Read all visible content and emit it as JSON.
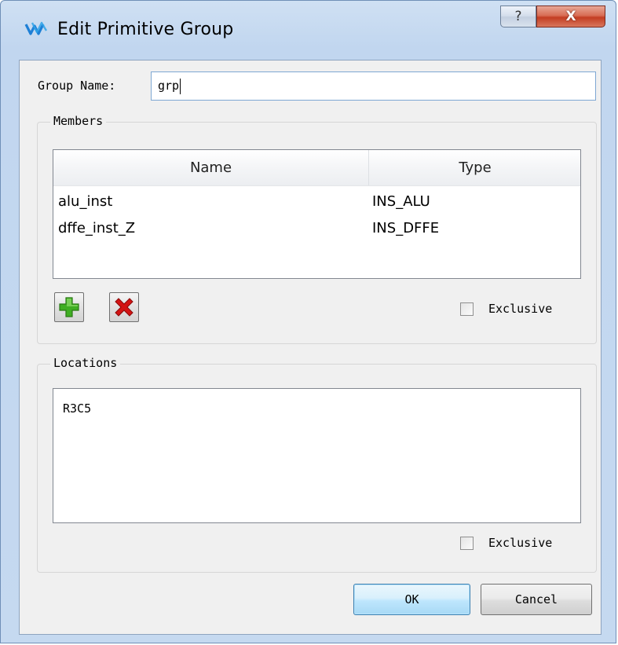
{
  "window": {
    "title": "Edit Primitive Group",
    "help_glyph": "?",
    "close_glyph": "X"
  },
  "group_name": {
    "label": "Group Name:",
    "value": "grp"
  },
  "members": {
    "title": "Members",
    "columns": [
      "Name",
      "Type"
    ],
    "rows": [
      {
        "name": "alu_inst",
        "type": "INS_ALU"
      },
      {
        "name": "dffe_inst_Z",
        "type": "INS_DFFE"
      }
    ],
    "exclusive_label": "Exclusive",
    "exclusive_checked": false
  },
  "locations": {
    "title": "Locations",
    "value": "R3C5",
    "exclusive_label": "Exclusive",
    "exclusive_checked": false
  },
  "buttons": {
    "ok": "OK",
    "cancel": "Cancel"
  },
  "icons": {
    "app": "app-logo-icon",
    "add": "plus-icon",
    "remove": "delete-x-icon"
  },
  "colors": {
    "add_icon": "#3fae22",
    "remove_icon": "#d31414",
    "ok_border": "#3c7fb1"
  }
}
